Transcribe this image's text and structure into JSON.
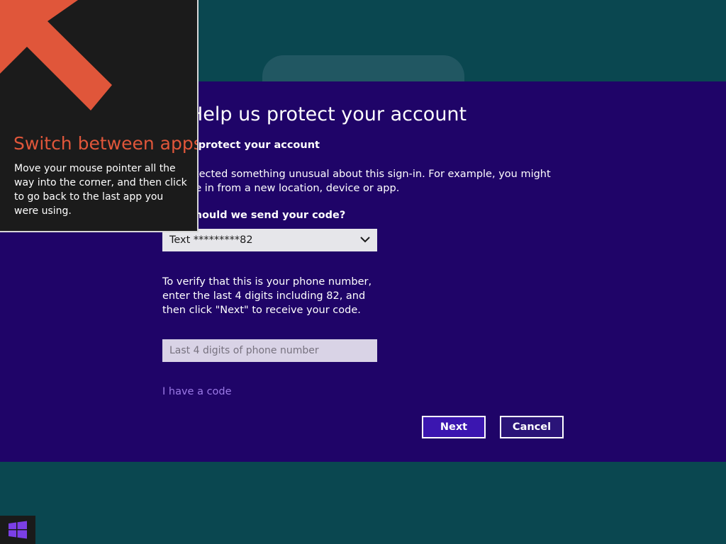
{
  "colors": {
    "desktop_background": "#0a4750",
    "dialog_background": "#1f0468",
    "tip_accent": "#e0563a",
    "link": "#9b7ae6",
    "next_button": "#3b16b0",
    "windows_logo": "#7b3fe6"
  },
  "dialog": {
    "title": "Help us protect your account",
    "subtitle": "s protect your account",
    "description": "etected something unusual about this sign-in. For example, you might be in from a new location, device or app.",
    "send_code_label": "should we send your code?",
    "code_method": {
      "selected": "Text *********82",
      "icon": "chevron-down-icon"
    },
    "verify_text": "To verify that this is your phone number, enter the last 4 digits including 82, and then click \"Next\" to receive your code.",
    "digits_input": {
      "value": "",
      "placeholder": "Last 4 digits of phone number"
    },
    "have_code_link": "I have a code",
    "next_label": "Next",
    "cancel_label": "Cancel"
  },
  "tip": {
    "icon": "arrow-up-left-icon",
    "title": "Switch between apps",
    "body": "Move your mouse pointer all the way into the corner, and then click to go back to the last app you were using."
  },
  "taskbar": {
    "start_icon": "windows-logo-icon"
  }
}
